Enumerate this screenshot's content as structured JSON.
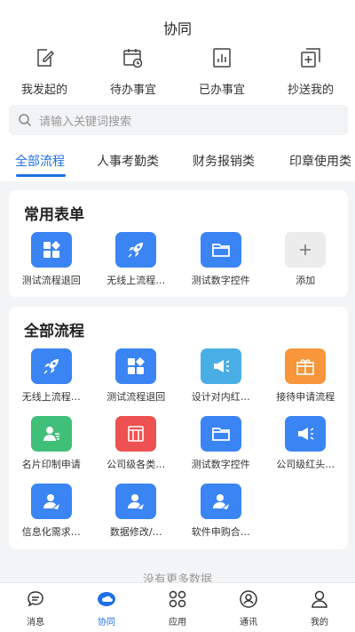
{
  "header": {
    "title": "协同",
    "quick_actions": [
      {
        "label": "我发起的",
        "icon": "edit-document-icon"
      },
      {
        "label": "待办事宜",
        "icon": "calendar-clock-icon"
      },
      {
        "label": "已办事宜",
        "icon": "bar-chart-document-icon"
      },
      {
        "label": "抄送我的",
        "icon": "copy-add-icon"
      }
    ]
  },
  "search": {
    "placeholder": "请输入关键词搜索"
  },
  "tabs": [
    {
      "label": "全部流程",
      "active": true
    },
    {
      "label": "人事考勤类",
      "active": false
    },
    {
      "label": "财务报销类",
      "active": false
    },
    {
      "label": "印章使用类",
      "active": false
    }
  ],
  "common_forms": {
    "title": "常用表单",
    "items": [
      {
        "label": "测试流程退回",
        "icon": "grid-icon",
        "color": "#3a85f3"
      },
      {
        "label": "无线上流程…",
        "icon": "rocket-icon",
        "color": "#3a85f3"
      },
      {
        "label": "测试数字控件",
        "icon": "folder-icon",
        "color": "#3a85f3"
      },
      {
        "label": "添加",
        "icon": "plus-icon",
        "color": "#ececec"
      }
    ]
  },
  "all_flows": {
    "title": "全部流程",
    "items": [
      {
        "label": "无线上流程…",
        "icon": "rocket-icon",
        "color": "#3a85f3"
      },
      {
        "label": "测试流程退回",
        "icon": "grid-icon",
        "color": "#3a85f3"
      },
      {
        "label": "设计对内红…",
        "icon": "megaphone-icon",
        "color": "#4aaee6"
      },
      {
        "label": "接待申请流程",
        "icon": "gift-icon",
        "color": "#f7963a"
      },
      {
        "label": "名片印制申请",
        "icon": "contact-card-icon",
        "color": "#3fbf78"
      },
      {
        "label": "公司级各类…",
        "icon": "calculator-icon",
        "color": "#ee5151"
      },
      {
        "label": "测试数字控件",
        "icon": "folder-icon",
        "color": "#3a85f3"
      },
      {
        "label": "公司级红头…",
        "icon": "megaphone-icon",
        "color": "#3a85f3"
      },
      {
        "label": "信息化需求…",
        "icon": "user-send-icon",
        "color": "#3a85f3"
      },
      {
        "label": "数据修改/…",
        "icon": "user-send-icon",
        "color": "#3a85f3"
      },
      {
        "label": "软件申购合…",
        "icon": "user-send-icon",
        "color": "#3a85f3"
      }
    ]
  },
  "footer_text": "没有更多数据",
  "bottom_nav": [
    {
      "label": "消息",
      "icon": "chat-icon",
      "active": false
    },
    {
      "label": "协同",
      "icon": "cloud-icon",
      "active": true
    },
    {
      "label": "应用",
      "icon": "apps-icon",
      "active": false
    },
    {
      "label": "通讯",
      "icon": "contacts-icon",
      "active": false
    },
    {
      "label": "我的",
      "icon": "profile-icon",
      "active": false
    }
  ],
  "colors": {
    "accent": "#1f6fe5",
    "app_blue": "#3a85f3"
  }
}
